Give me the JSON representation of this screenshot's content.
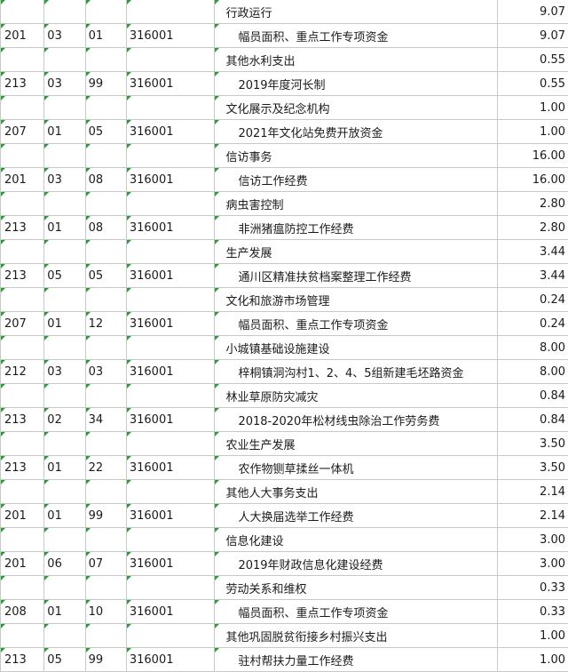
{
  "rows": [
    {
      "type": "category",
      "c0": "",
      "c1": "",
      "c2": "",
      "c3": "",
      "name": "行政运行",
      "amount": "9.07"
    },
    {
      "type": "detail",
      "c0": "201",
      "c1": "03",
      "c2": "01",
      "c3": "316001",
      "name": "幅员面积、重点工作专项资金",
      "amount": "9.07"
    },
    {
      "type": "category",
      "c0": "",
      "c1": "",
      "c2": "",
      "c3": "",
      "name": "其他水利支出",
      "amount": "0.55"
    },
    {
      "type": "detail",
      "c0": "213",
      "c1": "03",
      "c2": "99",
      "c3": "316001",
      "name": "2019年度河长制",
      "amount": "0.55"
    },
    {
      "type": "category",
      "c0": "",
      "c1": "",
      "c2": "",
      "c3": "",
      "name": "文化展示及纪念机构",
      "amount": "1.00"
    },
    {
      "type": "detail",
      "c0": "207",
      "c1": "01",
      "c2": "05",
      "c3": "316001",
      "name": "2021年文化站免费开放资金",
      "amount": "1.00"
    },
    {
      "type": "category",
      "c0": "",
      "c1": "",
      "c2": "",
      "c3": "",
      "name": "信访事务",
      "amount": "16.00"
    },
    {
      "type": "detail",
      "c0": "201",
      "c1": "03",
      "c2": "08",
      "c3": "316001",
      "name": "信访工作经费",
      "amount": "16.00"
    },
    {
      "type": "category",
      "c0": "",
      "c1": "",
      "c2": "",
      "c3": "",
      "name": "病虫害控制",
      "amount": "2.80"
    },
    {
      "type": "detail",
      "c0": "213",
      "c1": "01",
      "c2": "08",
      "c3": "316001",
      "name": "非洲猪瘟防控工作经费",
      "amount": "2.80"
    },
    {
      "type": "category",
      "c0": "",
      "c1": "",
      "c2": "",
      "c3": "",
      "name": "生产发展",
      "amount": "3.44"
    },
    {
      "type": "detail",
      "c0": "213",
      "c1": "05",
      "c2": "05",
      "c3": "316001",
      "name": "通川区精准扶贫档案整理工作经费",
      "amount": "3.44"
    },
    {
      "type": "category",
      "c0": "",
      "c1": "",
      "c2": "",
      "c3": "",
      "name": "文化和旅游市场管理",
      "amount": "0.24"
    },
    {
      "type": "detail",
      "c0": "207",
      "c1": "01",
      "c2": "12",
      "c3": "316001",
      "name": "幅员面积、重点工作专项资金",
      "amount": "0.24"
    },
    {
      "type": "category",
      "c0": "",
      "c1": "",
      "c2": "",
      "c3": "",
      "name": "小城镇基础设施建设",
      "amount": "8.00"
    },
    {
      "type": "detail",
      "c0": "212",
      "c1": "03",
      "c2": "03",
      "c3": "316001",
      "name": "梓桐镇洞沟村1、2、4、5组新建毛坯路资金",
      "amount": "8.00"
    },
    {
      "type": "category",
      "c0": "",
      "c1": "",
      "c2": "",
      "c3": "",
      "name": "林业草原防灾减灾",
      "amount": "0.84"
    },
    {
      "type": "detail",
      "c0": "213",
      "c1": "02",
      "c2": "34",
      "c3": "316001",
      "name": "2018-2020年松材线虫除治工作劳务费",
      "amount": "0.84"
    },
    {
      "type": "category",
      "c0": "",
      "c1": "",
      "c2": "",
      "c3": "",
      "name": "农业生产发展",
      "amount": "3.50"
    },
    {
      "type": "detail",
      "c0": "213",
      "c1": "01",
      "c2": "22",
      "c3": "316001",
      "name": "农作物铡草揉丝一体机",
      "amount": "3.50"
    },
    {
      "type": "category",
      "c0": "",
      "c1": "",
      "c2": "",
      "c3": "",
      "name": "其他人大事务支出",
      "amount": "2.14"
    },
    {
      "type": "detail",
      "c0": "201",
      "c1": "01",
      "c2": "99",
      "c3": "316001",
      "name": "人大换届选举工作经费",
      "amount": "2.14"
    },
    {
      "type": "category",
      "c0": "",
      "c1": "",
      "c2": "",
      "c3": "",
      "name": "信息化建设",
      "amount": "3.00"
    },
    {
      "type": "detail",
      "c0": "201",
      "c1": "06",
      "c2": "07",
      "c3": "316001",
      "name": "2019年财政信息化建设经费",
      "amount": "3.00"
    },
    {
      "type": "category",
      "c0": "",
      "c1": "",
      "c2": "",
      "c3": "",
      "name": "劳动关系和维权",
      "amount": "0.33"
    },
    {
      "type": "detail",
      "c0": "208",
      "c1": "01",
      "c2": "10",
      "c3": "316001",
      "name": "幅员面积、重点工作专项资金",
      "amount": "0.33"
    },
    {
      "type": "category",
      "c0": "",
      "c1": "",
      "c2": "",
      "c3": "",
      "name": "其他巩固脱贫衔接乡村振兴支出",
      "amount": "1.00"
    },
    {
      "type": "detail",
      "c0": "213",
      "c1": "05",
      "c2": "99",
      "c3": "316001",
      "name": "驻村帮扶力量工作经费",
      "amount": "1.00"
    }
  ]
}
